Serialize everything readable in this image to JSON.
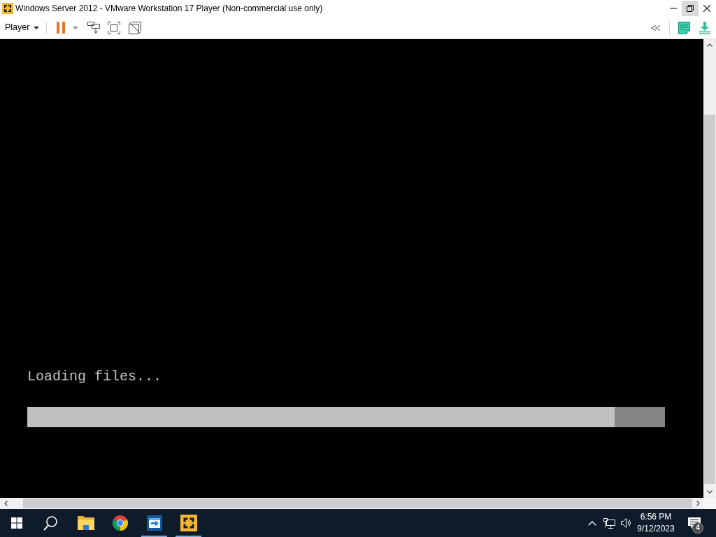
{
  "window": {
    "title": "Windows Server 2012 - VMware Workstation 17 Player (Non-commercial use only)",
    "controls": [
      {
        "kind": "minimize",
        "hovered": false
      },
      {
        "kind": "restore",
        "hovered": true
      },
      {
        "kind": "close",
        "hovered": false
      }
    ]
  },
  "toolbar": {
    "menu_label": "Player"
  },
  "vm_screen": {
    "message": "Loading files...",
    "progress": {
      "level": 0.921
    }
  },
  "taskbar": {
    "apps": [
      {
        "kind": "folder",
        "running": false
      },
      {
        "kind": "browser",
        "running": false
      },
      {
        "kind": "remote",
        "running": true
      },
      {
        "kind": "player",
        "running": true
      }
    ],
    "clock_time": "6:56 PM",
    "clock_date": "9/12/2023",
    "notification_count": "4"
  }
}
